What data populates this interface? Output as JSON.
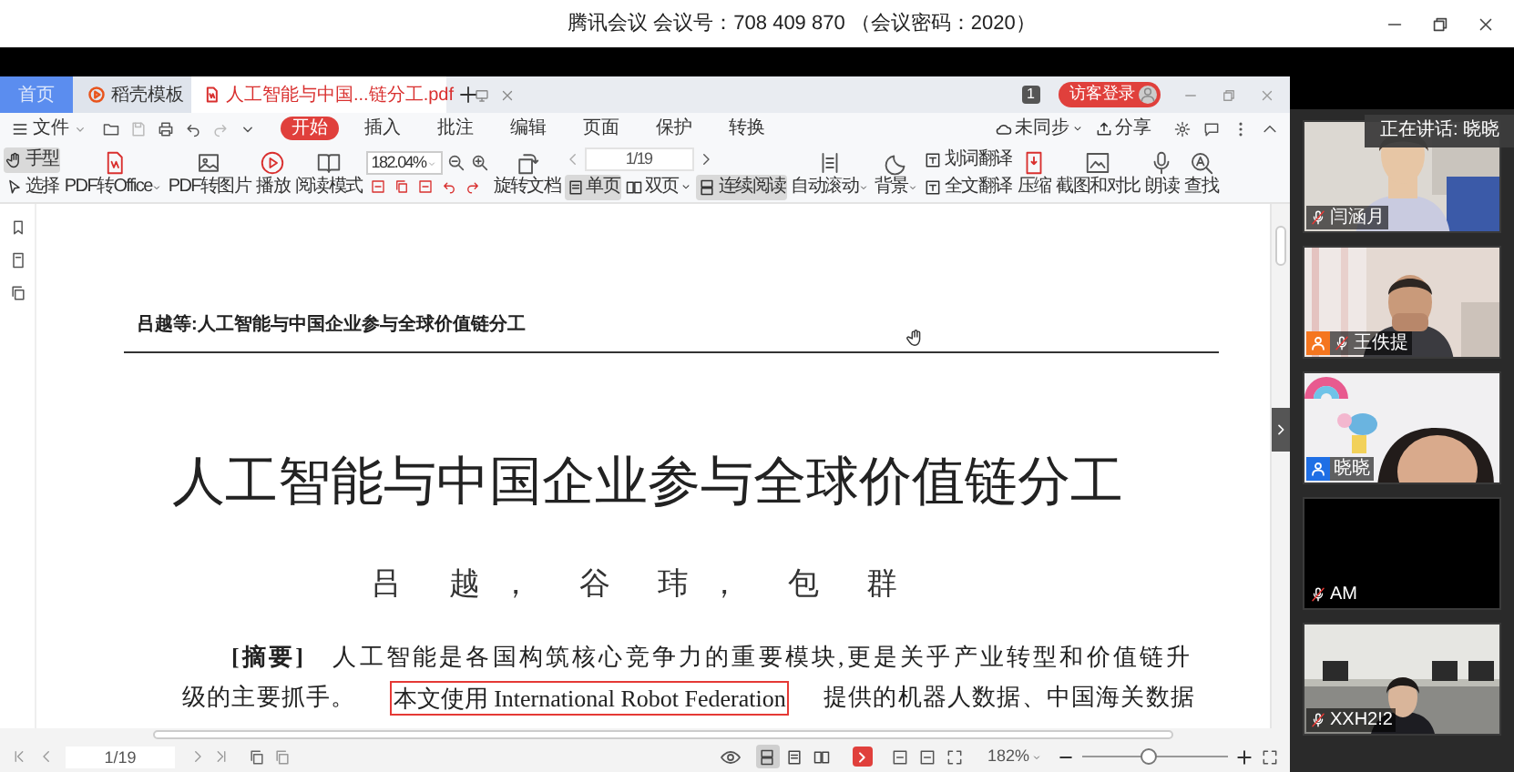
{
  "meeting": {
    "title": "腾讯会议 会议号：708 409 870 （会议密码：2020）",
    "speaker_tip": "正在讲话: 晓晓",
    "participants": [
      {
        "name": "闫涵月",
        "video": true,
        "muted": true
      },
      {
        "name": "王佚提",
        "video": true,
        "muted": true,
        "color": "#f5761f"
      },
      {
        "name": "晓晓",
        "video": true,
        "muted": false,
        "color": "#1f6fe5"
      },
      {
        "name": "AM",
        "video": false,
        "muted": true
      },
      {
        "name": "XXH2!2",
        "video": true,
        "muted": true
      }
    ]
  },
  "tabs": [
    {
      "label": "首页",
      "selected": false
    },
    {
      "label": "稻壳模板",
      "selected": false
    },
    {
      "label": "人工智能与中国...链分工.pdf",
      "selected": true
    }
  ],
  "page_badge": "1",
  "login_button": "访客登录",
  "menu": {
    "file": "文件",
    "items": [
      {
        "label": "开始",
        "selected": true
      },
      {
        "label": "插入",
        "selected": false
      },
      {
        "label": "批注",
        "selected": false
      },
      {
        "label": "编辑",
        "selected": false
      },
      {
        "label": "页面",
        "selected": false
      },
      {
        "label": "保护",
        "selected": false
      },
      {
        "label": "转换",
        "selected": false
      }
    ],
    "sync": "未同步",
    "share": "分享"
  },
  "toolbar": {
    "hand_tool": {
      "label": "手型",
      "selected": true
    },
    "select_tool": {
      "label": "选择",
      "selected": false
    },
    "tools_1": [
      {
        "label": "PDF转Office",
        "dropdown": true
      },
      {
        "label": "PDF转图片",
        "dropdown": false
      },
      {
        "label": "播放",
        "dropdown": false
      },
      {
        "label": "阅读模式",
        "dropdown": false
      }
    ],
    "zoom": "182.04%",
    "rotate": "旋转文档",
    "page_field": "1/19",
    "views": [
      {
        "label": "单页",
        "selected": true,
        "dropdown": false
      },
      {
        "label": "双页",
        "selected": false,
        "dropdown": true
      },
      {
        "label": "连续阅读",
        "selected": true,
        "dropdown": false
      }
    ],
    "tools_2": [
      {
        "label": "自动滚动",
        "dropdown": true
      },
      {
        "label": "背景",
        "dropdown": true
      }
    ],
    "translate": [
      "划词翻译",
      "全文翻译"
    ],
    "tools_3": [
      "压缩",
      "截图和对比",
      "朗读",
      "查找"
    ]
  },
  "document": {
    "running_head": "吕越等:人工智能与中国企业参与全球价值链分工",
    "title": "人工智能与中国企业参与全球价值链分工",
    "authors": "吕 越， 谷 玮， 包 群",
    "abstract_lines": [
      [
        {
          "text": "**[摘要]**　人工智能是各国构筑核心竞争力的重要模块,更是关乎产业转型和价值链升",
          "boxed": false
        }
      ],
      [
        {
          "text": "级的主要抓手。",
          "boxed": false
        },
        {
          "text": "本文使用 International Robot Federation",
          "boxed": true
        },
        {
          "text": "提供的机器人数据、中国海关数据",
          "boxed": false
        }
      ]
    ]
  },
  "status_bar": {
    "page_field": "1/19",
    "view_buttons": [
      {
        "selected": true
      },
      {
        "selected": false
      },
      {
        "selected": false
      }
    ],
    "zoom": "182%",
    "zoom_slider": {
      "level": 0.45
    }
  }
}
